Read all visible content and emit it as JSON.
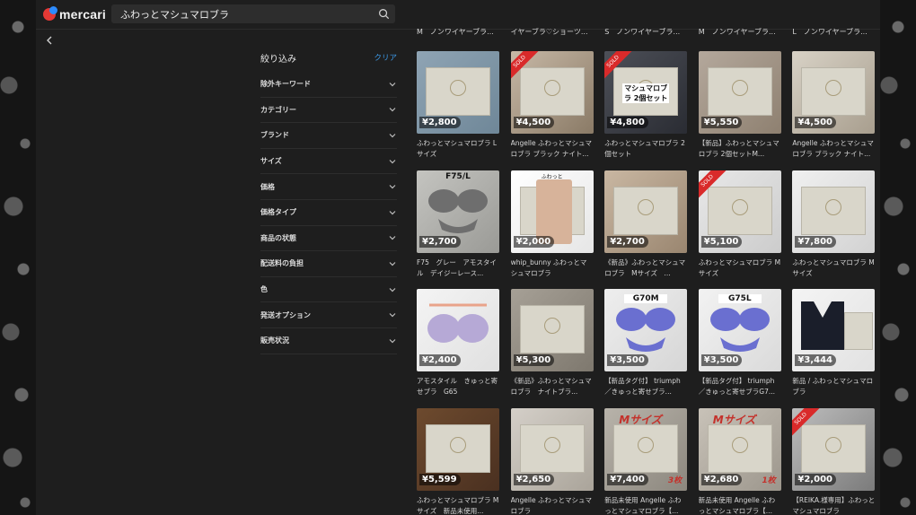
{
  "header": {
    "logo_text": "mercari",
    "search_value": "ふわっとマシュマロブラ"
  },
  "filters": {
    "title": "絞り込み",
    "clear_label": "クリア",
    "items": [
      "除外キーワード",
      "カテゴリー",
      "ブランド",
      "サイズ",
      "価格",
      "価格タイプ",
      "商品の状態",
      "配送料の負担",
      "色",
      "発送オプション",
      "販売状況"
    ]
  },
  "top_captions": [
    "M　ノンワイヤーブラ...",
    "イヤーブラ♡ショーツ...",
    "S　ノンワイヤーブラ...",
    "M　ノンワイヤーブラ...",
    "L　ノンワイヤーブラ..."
  ],
  "items": [
    {
      "price": "¥2,800",
      "title": "ふわっとマシュマロブラ Lサイズ",
      "sold": false,
      "overlay": ""
    },
    {
      "price": "¥4,500",
      "title": "Angelle ふわっとマシュマロブラ ブラック ナイト...",
      "sold": true,
      "overlay": ""
    },
    {
      "price": "¥4,800",
      "title": "ふわっとマシュマロブラ 2個セット",
      "sold": true,
      "overlay": "マシュマロブラ 2個セット"
    },
    {
      "price": "¥5,550",
      "title": "【新品】ふわっとマシュマロブラ 2個セットM...",
      "sold": false,
      "overlay": ""
    },
    {
      "price": "¥4,500",
      "title": "Angelle ふわっとマシュマロブラ ブラック ナイト...",
      "sold": false,
      "overlay": ""
    },
    {
      "price": "¥2,700",
      "title": "F75　グレー　アモスタイル　デイジーレース...",
      "sold": false,
      "overlay": "F75/L"
    },
    {
      "price": "¥2,000",
      "title": "whip_bunny ふわっとマシュマロブラ",
      "sold": false,
      "overlay": ""
    },
    {
      "price": "¥2,700",
      "title": "《新品》ふわっとマシュマロブラ　Mサイズ　...",
      "sold": false,
      "overlay": ""
    },
    {
      "price": "¥5,100",
      "title": "ふわっとマシュマロブラ Mサイズ",
      "sold": true,
      "overlay": ""
    },
    {
      "price": "¥7,800",
      "title": "ふわっとマシュマロブラ Mサイズ",
      "sold": false,
      "overlay": ""
    },
    {
      "price": "¥2,400",
      "title": "アモスタイル　きゅっと寄せブラ　G65",
      "sold": false,
      "overlay": ""
    },
    {
      "price": "¥5,300",
      "title": "《新品》ふわっとマシュマロブラ　ナイトブラ...",
      "sold": false,
      "overlay": ""
    },
    {
      "price": "¥3,500",
      "title": "【新品タグ付】 triumph／きゅっと寄せブラ...",
      "sold": false,
      "overlay": "G70M"
    },
    {
      "price": "¥3,500",
      "title": "【新品タグ付】 triumph／きゅっと寄せブラG7...",
      "sold": false,
      "overlay": "G75L"
    },
    {
      "price": "¥3,444",
      "title": "新品 / ふわっとマシュマロブラ",
      "sold": false,
      "overlay": ""
    },
    {
      "price": "¥5,599",
      "title": "ふわっとマシュマロブラ Mサイズ　新品未使用...",
      "sold": false,
      "overlay": ""
    },
    {
      "price": "¥2,650",
      "title": "Angelle ふわっとマシュマロブラ",
      "sold": false,
      "overlay": ""
    },
    {
      "price": "¥7,400",
      "title": "新品未使用 Angelle ふわっとマシュマロブラ【...",
      "sold": false,
      "overlay": "Mサイズ"
    },
    {
      "price": "¥2,680",
      "title": "新品未使用 Angelle ふわっとマシュマロブラ【...",
      "sold": false,
      "overlay": "Mサイズ"
    },
    {
      "price": "¥2,000",
      "title": "【REIKA.様専用】ふわっとマシュマロブラ",
      "sold": true,
      "overlay": ""
    }
  ],
  "sold_label": "SOLD",
  "qty_labels": {
    "three": "3枚",
    "one": "1枚"
  },
  "photo_caption": "ふわっと",
  "colors": {
    "accent": "#3d9be9",
    "sold": "#d92a2a",
    "background": "#1e1e1e"
  }
}
